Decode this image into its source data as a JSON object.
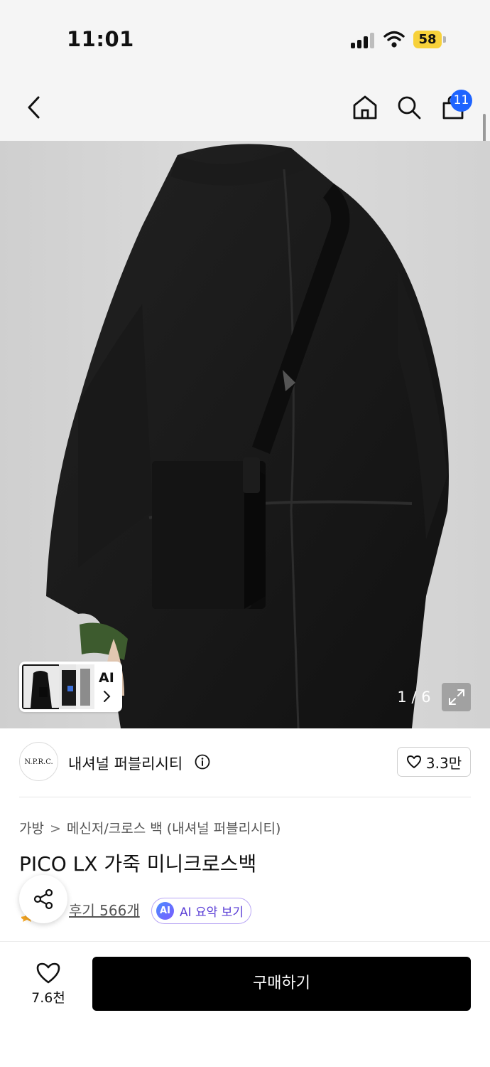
{
  "status_bar": {
    "time": "11:01",
    "battery_level": "58",
    "signal_icon": "cellular-signal-icon",
    "wifi_icon": "wifi-icon"
  },
  "header": {
    "back_icon": "chevron-left-icon",
    "home_icon": "home-icon",
    "search_icon": "search-icon",
    "cart_icon": "shopping-bag-icon",
    "cart_count": "11"
  },
  "gallery": {
    "thumbnail_ai_label": "AI",
    "page_counter": "1 / 6",
    "expand_icon": "expand-icon"
  },
  "brand": {
    "logo_text": "N.P.R.C.",
    "name": "내셔널 퍼블리시티",
    "like_count": "3.3만"
  },
  "product": {
    "breadcrumb": [
      "가방",
      "메신저/크로스 백 (내셔널 퍼블리시티)"
    ],
    "title": "PICO LX 가죽 미니크로스백",
    "review_link": "후기 566개",
    "ai_badge": "AI",
    "ai_summary_label": "AI 요약 보기"
  },
  "bottom_bar": {
    "wish_count": "7.6천",
    "buy_label": "구매하기"
  },
  "colors": {
    "accent_blue": "#1e64ff",
    "battery_yellow": "#f7d13a",
    "ai_purple": "#5b3fd6",
    "buy_button": "#000000"
  }
}
